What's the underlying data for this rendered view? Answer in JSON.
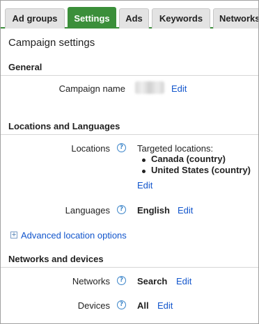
{
  "tabs": [
    {
      "label": "Ad groups",
      "active": false
    },
    {
      "label": "Settings",
      "active": true
    },
    {
      "label": "Ads",
      "active": false
    },
    {
      "label": "Keywords",
      "active": false
    },
    {
      "label": "Networks",
      "active": false
    }
  ],
  "page_title": "Campaign settings",
  "general": {
    "heading": "General",
    "campaign_name_label": "Campaign name",
    "campaign_name_value_redacted": true,
    "edit_label": "Edit"
  },
  "locations_languages": {
    "heading": "Locations and Languages",
    "locations_label": "Locations",
    "targeted_heading": "Targeted locations:",
    "targeted": [
      "Canada (country)",
      "United States (country)"
    ],
    "locations_edit": "Edit",
    "languages_label": "Languages",
    "languages_value": "English",
    "languages_edit": "Edit",
    "advanced_link": "Advanced location options"
  },
  "networks_devices": {
    "heading": "Networks and devices",
    "networks_label": "Networks",
    "networks_value": "Search",
    "networks_edit": "Edit",
    "devices_label": "Devices",
    "devices_value": "All",
    "devices_edit": "Edit"
  },
  "icons": {
    "help": "help-question-icon",
    "expand": "expand-plus-icon"
  },
  "colors": {
    "accent_green": "#3b8f3a",
    "link_blue": "#1155cc",
    "help_blue": "#3a84c9"
  }
}
